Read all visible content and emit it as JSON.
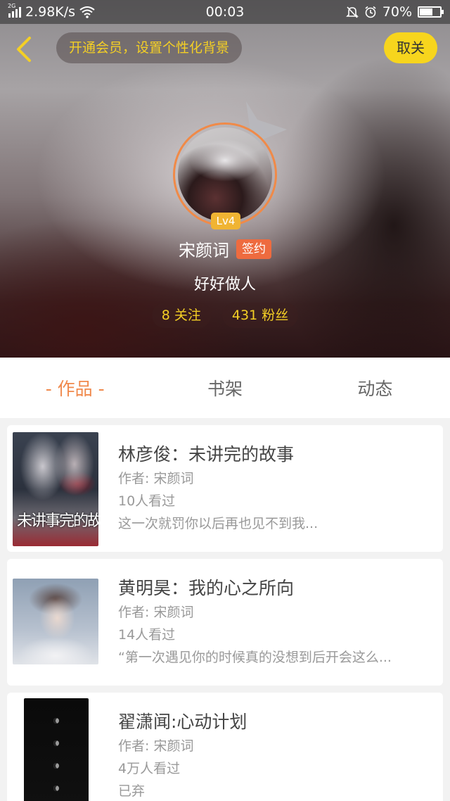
{
  "status_bar": {
    "network_type": "2G",
    "speed": "2.98K/s",
    "time": "00:03",
    "battery": "70%",
    "battery_level": 0.7
  },
  "header": {
    "vip_prompt": "开通会员，设置个性化背景",
    "unfollow_label": "取关"
  },
  "profile": {
    "level": "Lv4",
    "username": "宋颜词",
    "signed_label": "签约",
    "bio": "好好做人",
    "following": "8 关注",
    "followers": "431 粉丝"
  },
  "tabs": [
    {
      "label": "- 作品 -",
      "active": true
    },
    {
      "label": "书架",
      "active": false
    },
    {
      "label": "动态",
      "active": false
    }
  ],
  "books": [
    {
      "title": "林彦俊：未讲完的故事",
      "author": "作者: 宋颜词",
      "views": "10人看过",
      "excerpt": "这一次就罚你以后再也见不到我...",
      "cover_text": "未讲事完的故"
    },
    {
      "title": "黄明昊：我的心之所向",
      "author": "作者: 宋颜词",
      "views": "14人看过",
      "excerpt": "“第一次遇见你的时候真的没想到后开会这么..."
    },
    {
      "title": "翟潇闻:心动计划",
      "author": "作者: 宋颜词",
      "views": "4万人看过",
      "excerpt": "已弃"
    }
  ],
  "colors": {
    "accent_orange": "#f0894c",
    "accent_yellow": "#f7d51d",
    "signed_badge": "#ee6b3f",
    "level_badge": "#f0b433"
  }
}
